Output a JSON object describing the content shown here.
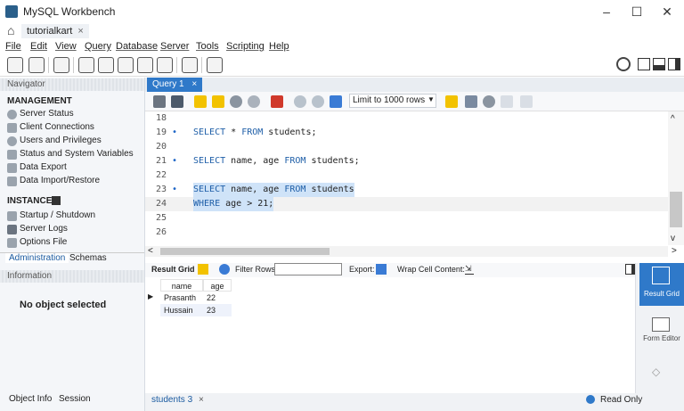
{
  "window": {
    "title": "MySQL Workbench",
    "controls": [
      "–",
      "☐",
      "✕"
    ]
  },
  "connection_tab": {
    "label": "tutorialkart",
    "close": "×"
  },
  "menu": [
    "File",
    "Edit",
    "View",
    "Query",
    "Database",
    "Server",
    "Tools",
    "Scripting",
    "Help"
  ],
  "navigator": {
    "header": "Navigator",
    "management_title": "MANAGEMENT",
    "management_items": [
      "Server Status",
      "Client Connections",
      "Users and Privileges",
      "Status and System Variables",
      "Data Export",
      "Data Import/Restore"
    ],
    "instance_title": "INSTANCE",
    "instance_items": [
      "Startup / Shutdown",
      "Server Logs",
      "Options File"
    ],
    "tabs": [
      "Administration",
      "Schemas"
    ]
  },
  "information": {
    "header": "Information",
    "empty": "No object selected",
    "tabs": [
      "Object Info",
      "Session"
    ]
  },
  "query_tab": {
    "label": "Query 1",
    "close": "×"
  },
  "query_toolbar": {
    "limit": "Limit to 1000 rows"
  },
  "editor": {
    "lines": [
      {
        "num": "18",
        "dot": "",
        "code": ""
      },
      {
        "num": "19",
        "dot": "•",
        "code": "SELECT * FROM students;"
      },
      {
        "num": "20",
        "dot": "",
        "code": ""
      },
      {
        "num": "21",
        "dot": "•",
        "code": "SELECT name, age FROM students;"
      },
      {
        "num": "22",
        "dot": "",
        "code": ""
      },
      {
        "num": "23",
        "dot": "•",
        "code": "SELECT name, age FROM students"
      },
      {
        "num": "24",
        "dot": "",
        "code": "WHERE age > 21;"
      },
      {
        "num": "25",
        "dot": "",
        "code": ""
      },
      {
        "num": "26",
        "dot": "",
        "code": ""
      }
    ]
  },
  "result": {
    "labels": {
      "grid": "Result Grid",
      "filter": "Filter Rows:",
      "export": "Export:",
      "wrap": "Wrap Cell Content:"
    },
    "columns": [
      "name",
      "age"
    ],
    "rows": [
      [
        "Prasanth",
        "22"
      ],
      [
        "Hussain",
        "23"
      ]
    ]
  },
  "side_panel": {
    "result_grid": "Result Grid",
    "form_editor": "Form Editor"
  },
  "status": {
    "result_tab": "students 3",
    "close": "×",
    "read_only": "Read Only"
  }
}
